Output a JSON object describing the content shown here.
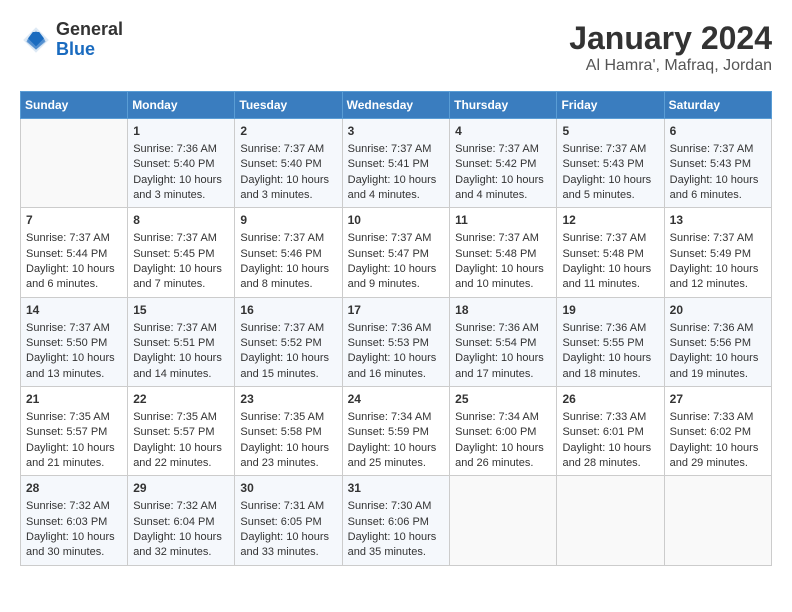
{
  "header": {
    "logo": {
      "general": "General",
      "blue": "Blue"
    },
    "title": "January 2024",
    "subtitle": "Al Hamra', Mafraq, Jordan"
  },
  "days_of_week": [
    "Sunday",
    "Monday",
    "Tuesday",
    "Wednesday",
    "Thursday",
    "Friday",
    "Saturday"
  ],
  "weeks": [
    [
      {
        "day": "",
        "data": ""
      },
      {
        "day": "1",
        "data": "Sunrise: 7:36 AM\nSunset: 5:40 PM\nDaylight: 10 hours\nand 3 minutes."
      },
      {
        "day": "2",
        "data": "Sunrise: 7:37 AM\nSunset: 5:40 PM\nDaylight: 10 hours\nand 3 minutes."
      },
      {
        "day": "3",
        "data": "Sunrise: 7:37 AM\nSunset: 5:41 PM\nDaylight: 10 hours\nand 4 minutes."
      },
      {
        "day": "4",
        "data": "Sunrise: 7:37 AM\nSunset: 5:42 PM\nDaylight: 10 hours\nand 4 minutes."
      },
      {
        "day": "5",
        "data": "Sunrise: 7:37 AM\nSunset: 5:43 PM\nDaylight: 10 hours\nand 5 minutes."
      },
      {
        "day": "6",
        "data": "Sunrise: 7:37 AM\nSunset: 5:43 PM\nDaylight: 10 hours\nand 6 minutes."
      }
    ],
    [
      {
        "day": "7",
        "data": "Sunrise: 7:37 AM\nSunset: 5:44 PM\nDaylight: 10 hours\nand 6 minutes."
      },
      {
        "day": "8",
        "data": "Sunrise: 7:37 AM\nSunset: 5:45 PM\nDaylight: 10 hours\nand 7 minutes."
      },
      {
        "day": "9",
        "data": "Sunrise: 7:37 AM\nSunset: 5:46 PM\nDaylight: 10 hours\nand 8 minutes."
      },
      {
        "day": "10",
        "data": "Sunrise: 7:37 AM\nSunset: 5:47 PM\nDaylight: 10 hours\nand 9 minutes."
      },
      {
        "day": "11",
        "data": "Sunrise: 7:37 AM\nSunset: 5:48 PM\nDaylight: 10 hours\nand 10 minutes."
      },
      {
        "day": "12",
        "data": "Sunrise: 7:37 AM\nSunset: 5:48 PM\nDaylight: 10 hours\nand 11 minutes."
      },
      {
        "day": "13",
        "data": "Sunrise: 7:37 AM\nSunset: 5:49 PM\nDaylight: 10 hours\nand 12 minutes."
      }
    ],
    [
      {
        "day": "14",
        "data": "Sunrise: 7:37 AM\nSunset: 5:50 PM\nDaylight: 10 hours\nand 13 minutes."
      },
      {
        "day": "15",
        "data": "Sunrise: 7:37 AM\nSunset: 5:51 PM\nDaylight: 10 hours\nand 14 minutes."
      },
      {
        "day": "16",
        "data": "Sunrise: 7:37 AM\nSunset: 5:52 PM\nDaylight: 10 hours\nand 15 minutes."
      },
      {
        "day": "17",
        "data": "Sunrise: 7:36 AM\nSunset: 5:53 PM\nDaylight: 10 hours\nand 16 minutes."
      },
      {
        "day": "18",
        "data": "Sunrise: 7:36 AM\nSunset: 5:54 PM\nDaylight: 10 hours\nand 17 minutes."
      },
      {
        "day": "19",
        "data": "Sunrise: 7:36 AM\nSunset: 5:55 PM\nDaylight: 10 hours\nand 18 minutes."
      },
      {
        "day": "20",
        "data": "Sunrise: 7:36 AM\nSunset: 5:56 PM\nDaylight: 10 hours\nand 19 minutes."
      }
    ],
    [
      {
        "day": "21",
        "data": "Sunrise: 7:35 AM\nSunset: 5:57 PM\nDaylight: 10 hours\nand 21 minutes."
      },
      {
        "day": "22",
        "data": "Sunrise: 7:35 AM\nSunset: 5:57 PM\nDaylight: 10 hours\nand 22 minutes."
      },
      {
        "day": "23",
        "data": "Sunrise: 7:35 AM\nSunset: 5:58 PM\nDaylight: 10 hours\nand 23 minutes."
      },
      {
        "day": "24",
        "data": "Sunrise: 7:34 AM\nSunset: 5:59 PM\nDaylight: 10 hours\nand 25 minutes."
      },
      {
        "day": "25",
        "data": "Sunrise: 7:34 AM\nSunset: 6:00 PM\nDaylight: 10 hours\nand 26 minutes."
      },
      {
        "day": "26",
        "data": "Sunrise: 7:33 AM\nSunset: 6:01 PM\nDaylight: 10 hours\nand 28 minutes."
      },
      {
        "day": "27",
        "data": "Sunrise: 7:33 AM\nSunset: 6:02 PM\nDaylight: 10 hours\nand 29 minutes."
      }
    ],
    [
      {
        "day": "28",
        "data": "Sunrise: 7:32 AM\nSunset: 6:03 PM\nDaylight: 10 hours\nand 30 minutes."
      },
      {
        "day": "29",
        "data": "Sunrise: 7:32 AM\nSunset: 6:04 PM\nDaylight: 10 hours\nand 32 minutes."
      },
      {
        "day": "30",
        "data": "Sunrise: 7:31 AM\nSunset: 6:05 PM\nDaylight: 10 hours\nand 33 minutes."
      },
      {
        "day": "31",
        "data": "Sunrise: 7:30 AM\nSunset: 6:06 PM\nDaylight: 10 hours\nand 35 minutes."
      },
      {
        "day": "",
        "data": ""
      },
      {
        "day": "",
        "data": ""
      },
      {
        "day": "",
        "data": ""
      }
    ]
  ]
}
